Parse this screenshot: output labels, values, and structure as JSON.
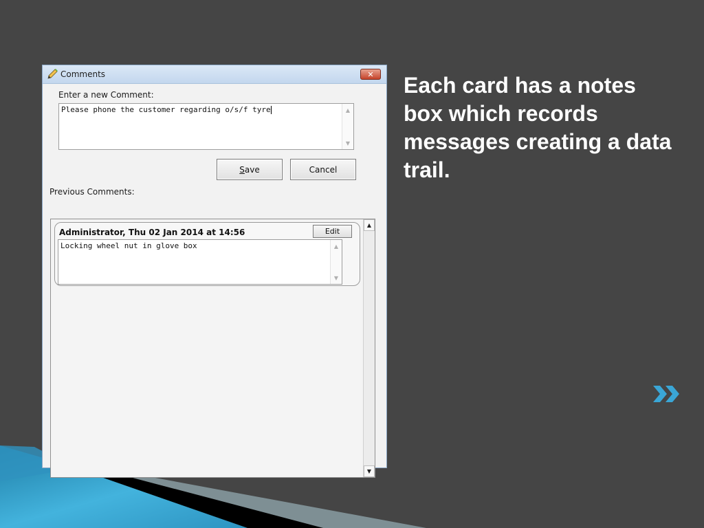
{
  "window": {
    "title": "Comments",
    "title_icon": "pencil-icon",
    "close_icon": "close-icon",
    "close_glyph": "✕"
  },
  "new_comment": {
    "label": "Enter a new Comment:",
    "value": "Please phone the customer regarding o/s/f tyre"
  },
  "buttons": {
    "save_prefix": "",
    "save_accel": "S",
    "save_rest": "ave",
    "cancel_label": "Cancel"
  },
  "previous": {
    "label": "Previous Comments:",
    "comments": [
      {
        "header": "Administrator, Thu 02 Jan 2014 at 14:56",
        "edit_label": "Edit",
        "text": "Locking wheel nut in glove box"
      }
    ]
  },
  "slide": {
    "text": "Each card has a notes box which records messages creating a data trail.",
    "next_icon": "double-chevron-right-icon"
  },
  "colors": {
    "background": "#454545",
    "accent": "#3aa6d6",
    "text": "#ffffff"
  }
}
